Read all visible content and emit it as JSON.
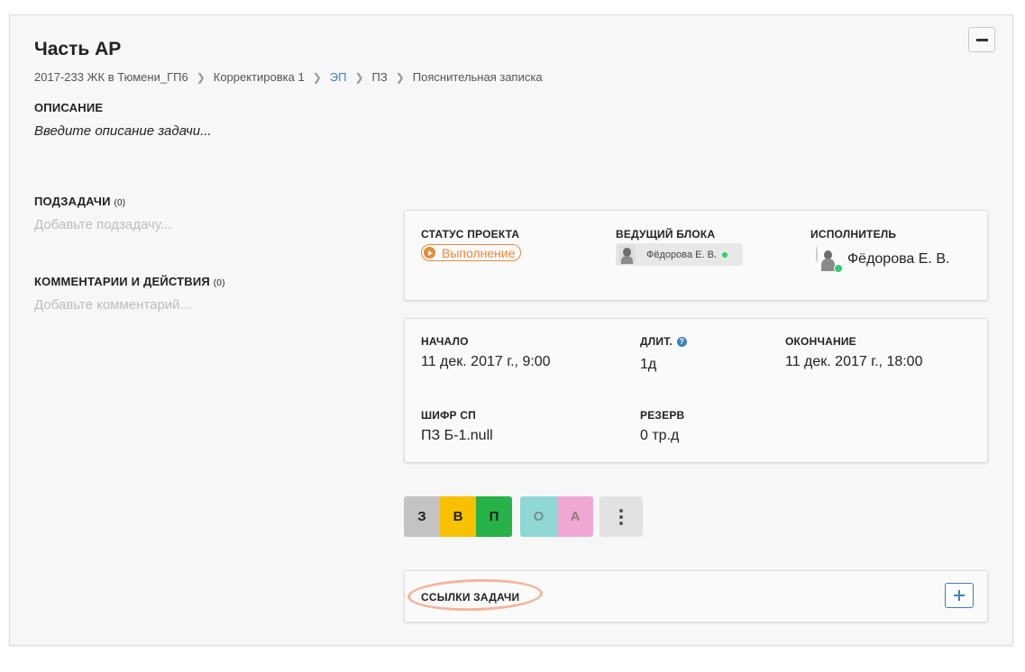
{
  "task": {
    "title": "Часть АР",
    "breadcrumb": [
      "2017-233 ЖК в Тюмени_ГП6",
      "Корректировка 1",
      "ЭП",
      "ПЗ",
      "Пояснительная записка"
    ]
  },
  "description": {
    "label": "ОПИСАНИЕ",
    "placeholder": "Введите описание задачи..."
  },
  "subtasks": {
    "label": "ПОДЗАДАЧИ",
    "count": "(0)",
    "placeholder": "Добавьте подзадачу..."
  },
  "comments": {
    "label": "КОММЕНТАРИИ И ДЕЙСТВИЯ",
    "count": "(0)",
    "placeholder": "Добавьте комментарий..."
  },
  "status_card": {
    "status_label": "СТАТУС ПРОЕКТА",
    "status_value": "Выполнение",
    "status_color": "#e8893a",
    "lead_label": "ВЕДУЩИЙ БЛОКА",
    "lead_name": "Фёдорова Е. В.",
    "assignee_label": "ИСПОЛНИТЕЛЬ",
    "assignee_name": "Фёдорова Е. В."
  },
  "dates_card": {
    "start_label": "НАЧАЛО",
    "start_value": "11 дек. 2017 г., 9:00",
    "duration_label": "ДЛИТ.",
    "duration_value": "1д",
    "duration_help_icon": "question-icon",
    "end_label": "ОКОНЧАНИЕ",
    "end_value": "11 дек. 2017 г., 18:00",
    "code_label": "ШИФР СП",
    "code_value": "ПЗ Б-1.null",
    "reserve_label": "РЕЗЕРВ",
    "reserve_value": "0 тр.д"
  },
  "stage_buttons": [
    {
      "label": "З",
      "color": "#c3c3c3",
      "text_color": "#222"
    },
    {
      "label": "В",
      "color": "#f8c100",
      "text_color": "#222"
    },
    {
      "label": "П",
      "color": "#27b34a",
      "text_color": "#222"
    }
  ],
  "extra_buttons": [
    {
      "label": "О",
      "color": "#8fd8d4",
      "text_color": "#7a8d8c"
    },
    {
      "label": "А",
      "color": "#f0a8d2",
      "text_color": "#8d7a86"
    }
  ],
  "links": {
    "label": "ССЫЛКИ ЗАДАЧИ",
    "add_icon": "plus-icon"
  },
  "colors": {
    "accent": "#3a7fc1",
    "online": "#2ecc71",
    "highlight": "#f2a88a"
  }
}
